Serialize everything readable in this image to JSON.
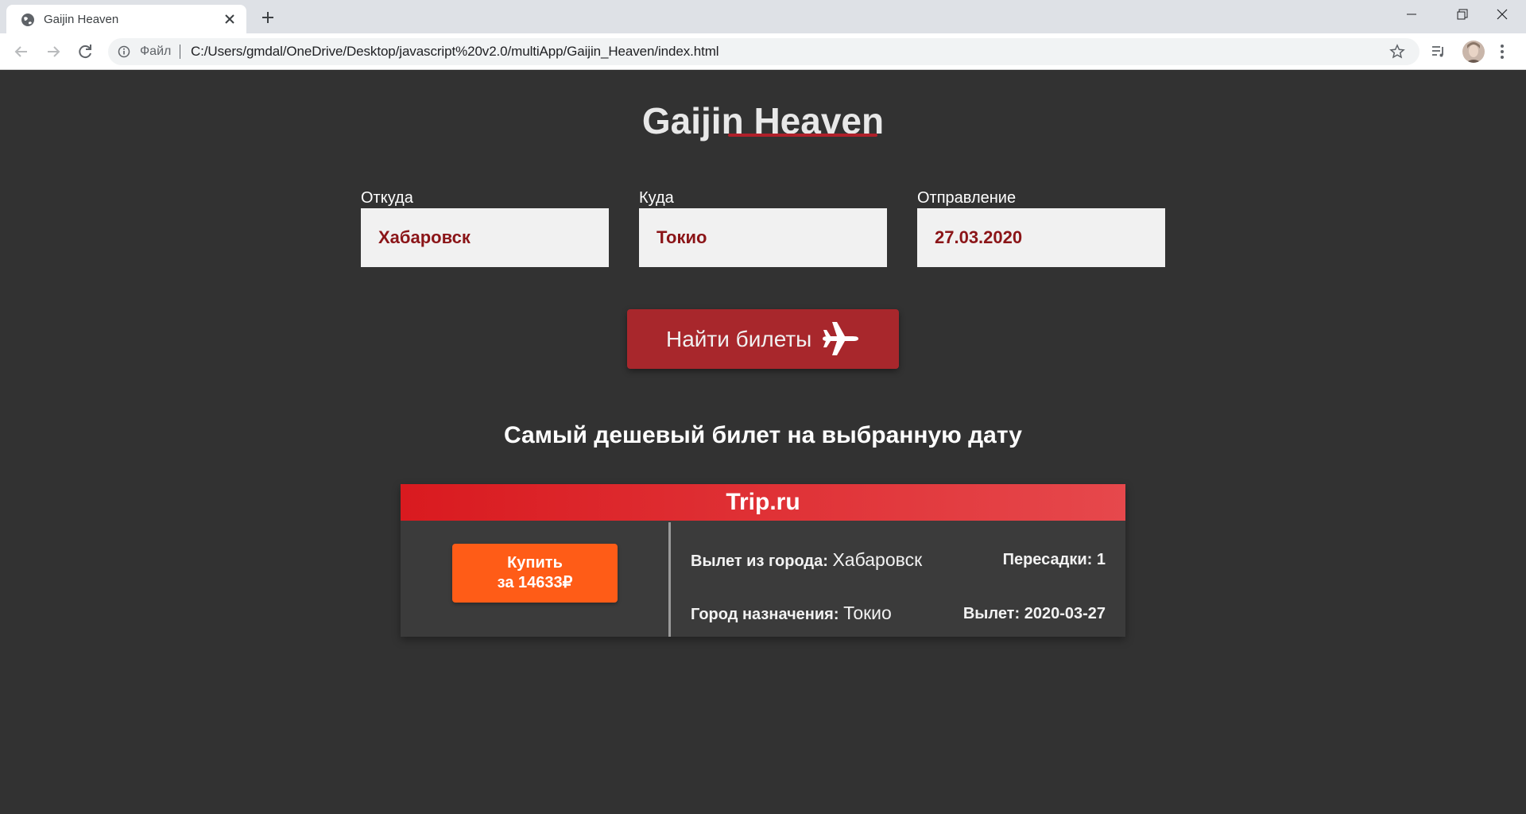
{
  "browser": {
    "tab_title": "Gaijin Heaven",
    "scheme_label": "Файл",
    "url": "C:/Users/gmdal/OneDrive/Desktop/javascript%20v2.0/multiApp/Gaijin_Heaven/index.html"
  },
  "page": {
    "title": "Gaijin Heaven",
    "form": {
      "from_label": "Откуда",
      "from_value": "Хабаровск",
      "to_label": "Куда",
      "to_value": "Токио",
      "date_label": "Отправление",
      "date_value": "27.03.2020"
    },
    "search_button": "Найти билеты",
    "cheapest_heading": "Самый дешевый билет на выбранную дату",
    "ticket": {
      "provider": "Trip.ru",
      "buy_line1": "Купить",
      "buy_line2": "за 14633₽",
      "from_label": "Вылет из города:",
      "from_value": "Хабаровск",
      "to_label": "Город назначения:",
      "to_value": "Токио",
      "transfers": "Пересадки: 1",
      "departure": "Вылет: 2020-03-27"
    }
  },
  "colors": {
    "background": "#323232",
    "accent": "#a8272c",
    "buy_button": "#ff5c17",
    "input_text": "#8b1518"
  }
}
